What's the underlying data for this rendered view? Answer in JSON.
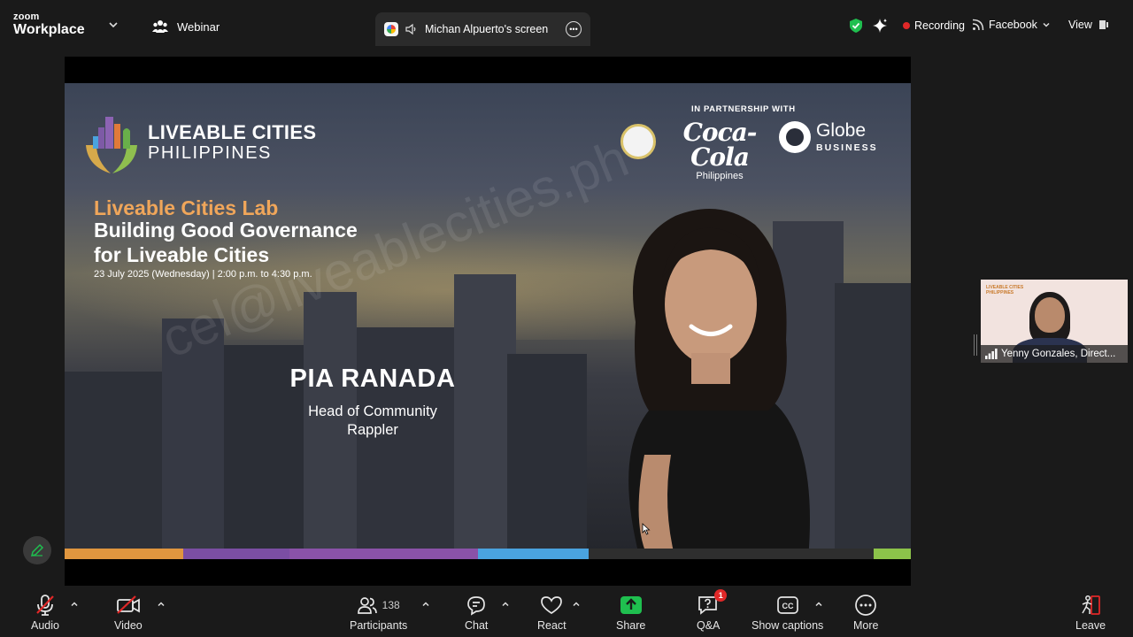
{
  "brand": {
    "line1": "zoom",
    "line2": "Workplace"
  },
  "header": {
    "webinar_label": "Webinar",
    "share_label": "Michan Alpuerto's screen",
    "recording_label": "Recording",
    "facebook_label": "Facebook",
    "view_label": "View"
  },
  "slide": {
    "org_line1": "LIVEABLE CITIES",
    "org_line2": "PHILIPPINES",
    "partners_label": "IN PARTNERSHIP WITH",
    "partner_cola_line1": "Coca-Cola",
    "partner_cola_line2": "Philippines",
    "partner_globe_line1": "Globe",
    "partner_globe_line2": "BUSINESS",
    "lab_title": "Liveable Cities Lab",
    "main_title_line1": "Building Good Governance",
    "main_title_line2": "for Liveable Cities",
    "event_date": "23 July 2025 (Wednesday) | 2:00 p.m. to 4:30 p.m.",
    "speaker_name": "PIA RANADA",
    "speaker_role_line1": "Head of Community",
    "speaker_role_line2": "Rappler",
    "watermark": "cel@liveablecities.ph"
  },
  "thumbnail": {
    "logo_line1": "LIVEABLE CITIES",
    "logo_line2": "PHILIPPINES",
    "participant_name": "Yenny Gonzales, Direct..."
  },
  "toolbar": {
    "audio": "Audio",
    "video": "Video",
    "participants": "Participants",
    "participants_count": "138",
    "chat": "Chat",
    "react": "React",
    "share": "Share",
    "qa": "Q&A",
    "qa_badge": "1",
    "captions": "Show captions",
    "more": "More",
    "leave": "Leave"
  },
  "colors": {
    "lab_title": "#f0a65a",
    "recording_dot": "#e02828",
    "share_green": "#1fbf4f",
    "shield_green": "#1fbf4f",
    "stripe": [
      "#e0963f",
      "#7b4ea3",
      "#8a52a8",
      "#4aa3df",
      "#2e2e2e",
      "#8cc34a"
    ]
  }
}
